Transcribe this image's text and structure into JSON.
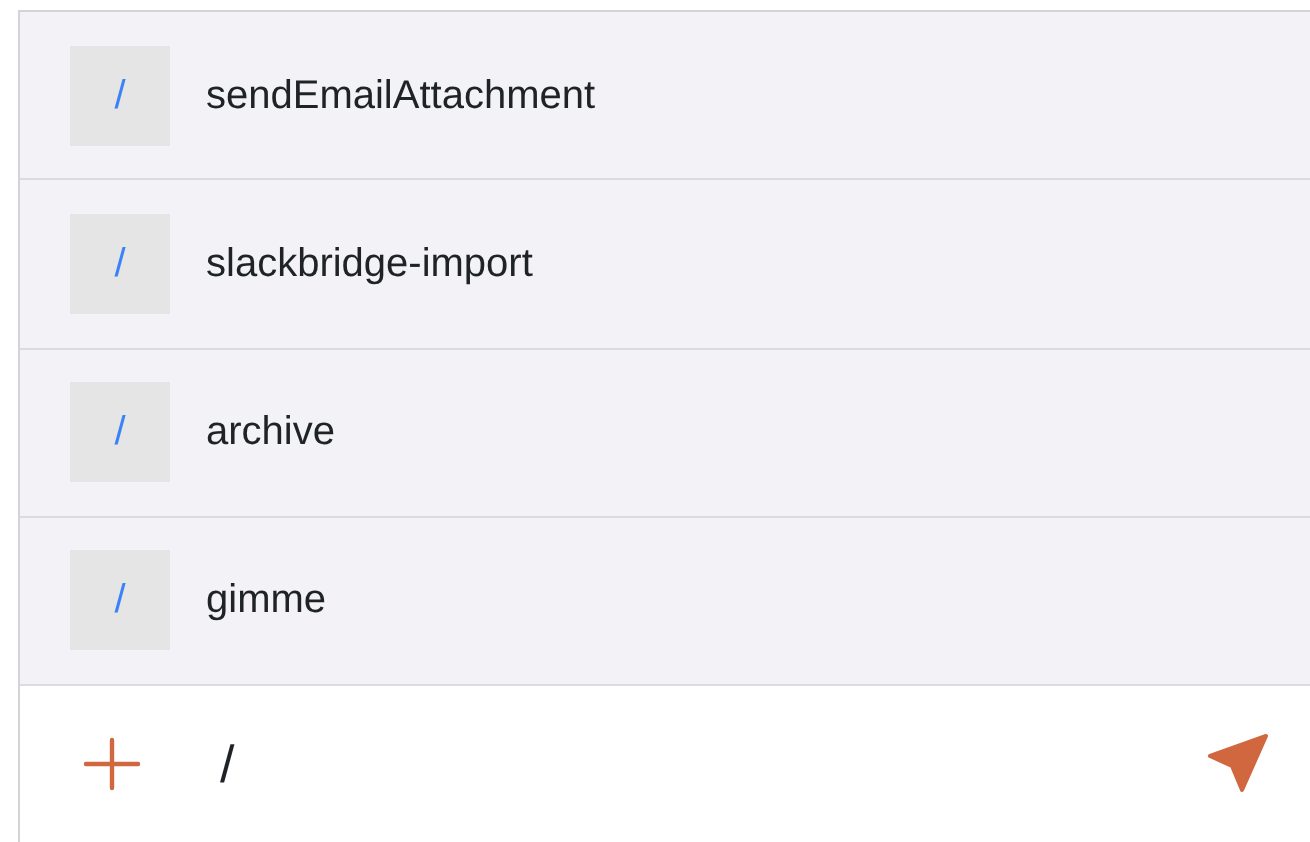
{
  "suggestions": [
    {
      "prefix": "/",
      "name": "sendEmailAttachment"
    },
    {
      "prefix": "/",
      "name": "slackbridge-import"
    },
    {
      "prefix": "/",
      "name": "archive"
    },
    {
      "prefix": "/",
      "name": "gimme"
    }
  ],
  "composer": {
    "value": "/"
  }
}
